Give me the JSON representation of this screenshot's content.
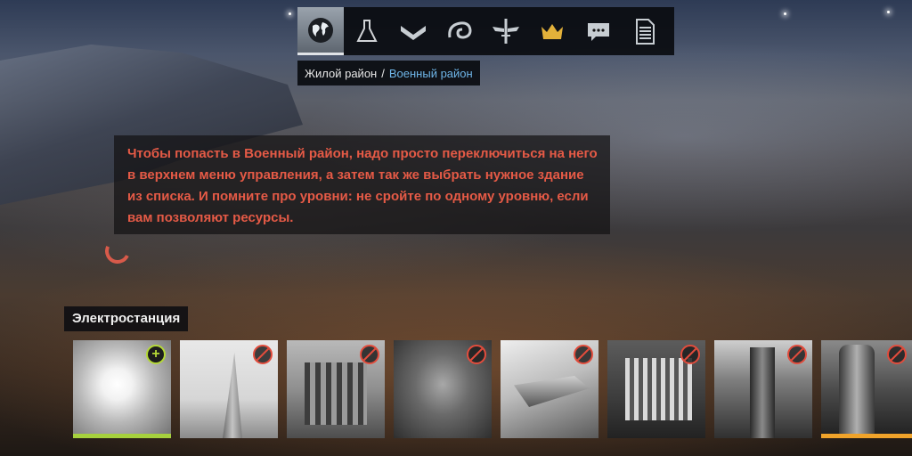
{
  "topbar": {
    "tabs": [
      {
        "icon": "globe-icon",
        "active": true
      },
      {
        "icon": "flask-icon",
        "active": false
      },
      {
        "icon": "chevron-rank-icon",
        "active": false
      },
      {
        "icon": "spiral-icon",
        "active": false
      },
      {
        "icon": "winged-sword-icon",
        "active": false
      },
      {
        "icon": "crown-icon",
        "active": false
      },
      {
        "icon": "chat-icon",
        "active": false
      },
      {
        "icon": "document-icon",
        "active": false
      }
    ],
    "crown_color": "#e3b13a"
  },
  "breadcrumb": {
    "item1": "Жилой район",
    "separator": "/",
    "item2": "Военный район"
  },
  "hint": {
    "text": "Чтобы попасть в Военный район, надо просто переключиться на него в верхнем меню управления, а затем так же выбрать нужное здание из списка. И помните про уровни: не сройте по одному уровню, если вам позволяют ресурсы.",
    "color": "#e55a46"
  },
  "section": {
    "title": "Электростанция"
  },
  "buildings": [
    {
      "badge": "add",
      "progress_color": "#a6d13d"
    },
    {
      "badge": "blocked"
    },
    {
      "badge": "blocked"
    },
    {
      "badge": "blocked"
    },
    {
      "badge": "blocked"
    },
    {
      "badge": "blocked"
    },
    {
      "badge": "blocked"
    },
    {
      "badge": "blocked",
      "progress_color": "#f0a32a"
    }
  ]
}
